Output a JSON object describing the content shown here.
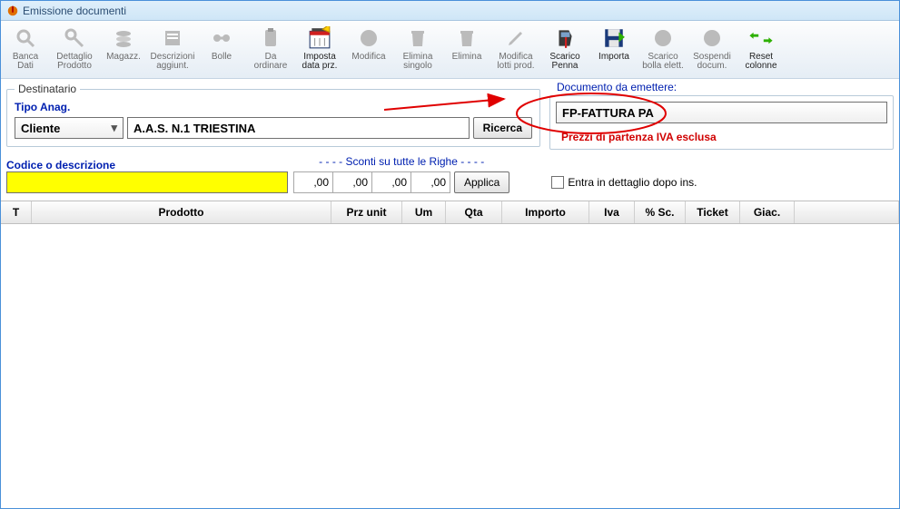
{
  "window": {
    "title": "Emissione documenti"
  },
  "toolbar": [
    {
      "label": "Banca\nDati",
      "icon": "magnifier"
    },
    {
      "label": "Dettaglio\nProdotto",
      "icon": "key"
    },
    {
      "label": "Magazz.",
      "icon": "stack"
    },
    {
      "label": "Descrizioni\naggiunt.",
      "icon": "note"
    },
    {
      "label": "Bolle",
      "icon": "doc"
    },
    {
      "label": "Da\nordinare",
      "icon": "clip"
    },
    {
      "label": "Imposta\ndata prz.",
      "icon": "calendar",
      "active": true
    },
    {
      "label": "Modifica",
      "icon": "circle"
    },
    {
      "label": "Elimina\nsingolo",
      "icon": "trash"
    },
    {
      "label": "Elimina",
      "icon": "trash"
    },
    {
      "label": "Modifica\nlotti prod.",
      "icon": "pencil"
    },
    {
      "label": "Scarico\nPenna",
      "icon": "scanner",
      "active": true
    },
    {
      "label": "Importa",
      "icon": "save",
      "active": true
    },
    {
      "label": "Scarico\nbolla elett.",
      "icon": "circle"
    },
    {
      "label": "Sospendi\ndocum.",
      "icon": "circle"
    },
    {
      "label": "Reset\ncolonne",
      "icon": "arrows",
      "active": true
    }
  ],
  "dest": {
    "legend": "Destinatario",
    "tipoAnagLabel": "Tipo Anag.",
    "tipoAnagValue": "Cliente",
    "nameValue": "A.A.S. N.1 TRIESTINA",
    "searchBtn": "Ricerca"
  },
  "doc": {
    "title": "Documento da emettere:",
    "selectValue": "FP-FATTURA PA",
    "priceNote": "Prezzi di partenza IVA esclusa"
  },
  "codice": {
    "label": "Codice o descrizione",
    "scontiLabel": "- - - - Sconti su tutte le Righe - - - -",
    "sconti": [
      ",00",
      ",00",
      ",00",
      ",00"
    ],
    "applyBtn": "Applica",
    "entraLabel": "Entra in dettaglio dopo ins."
  },
  "grid": {
    "columns": [
      "T",
      "Prodotto",
      "Prz unit",
      "Um",
      "Qta",
      "Importo",
      "Iva",
      "% Sc.",
      "Ticket",
      "Giac.",
      ""
    ]
  }
}
